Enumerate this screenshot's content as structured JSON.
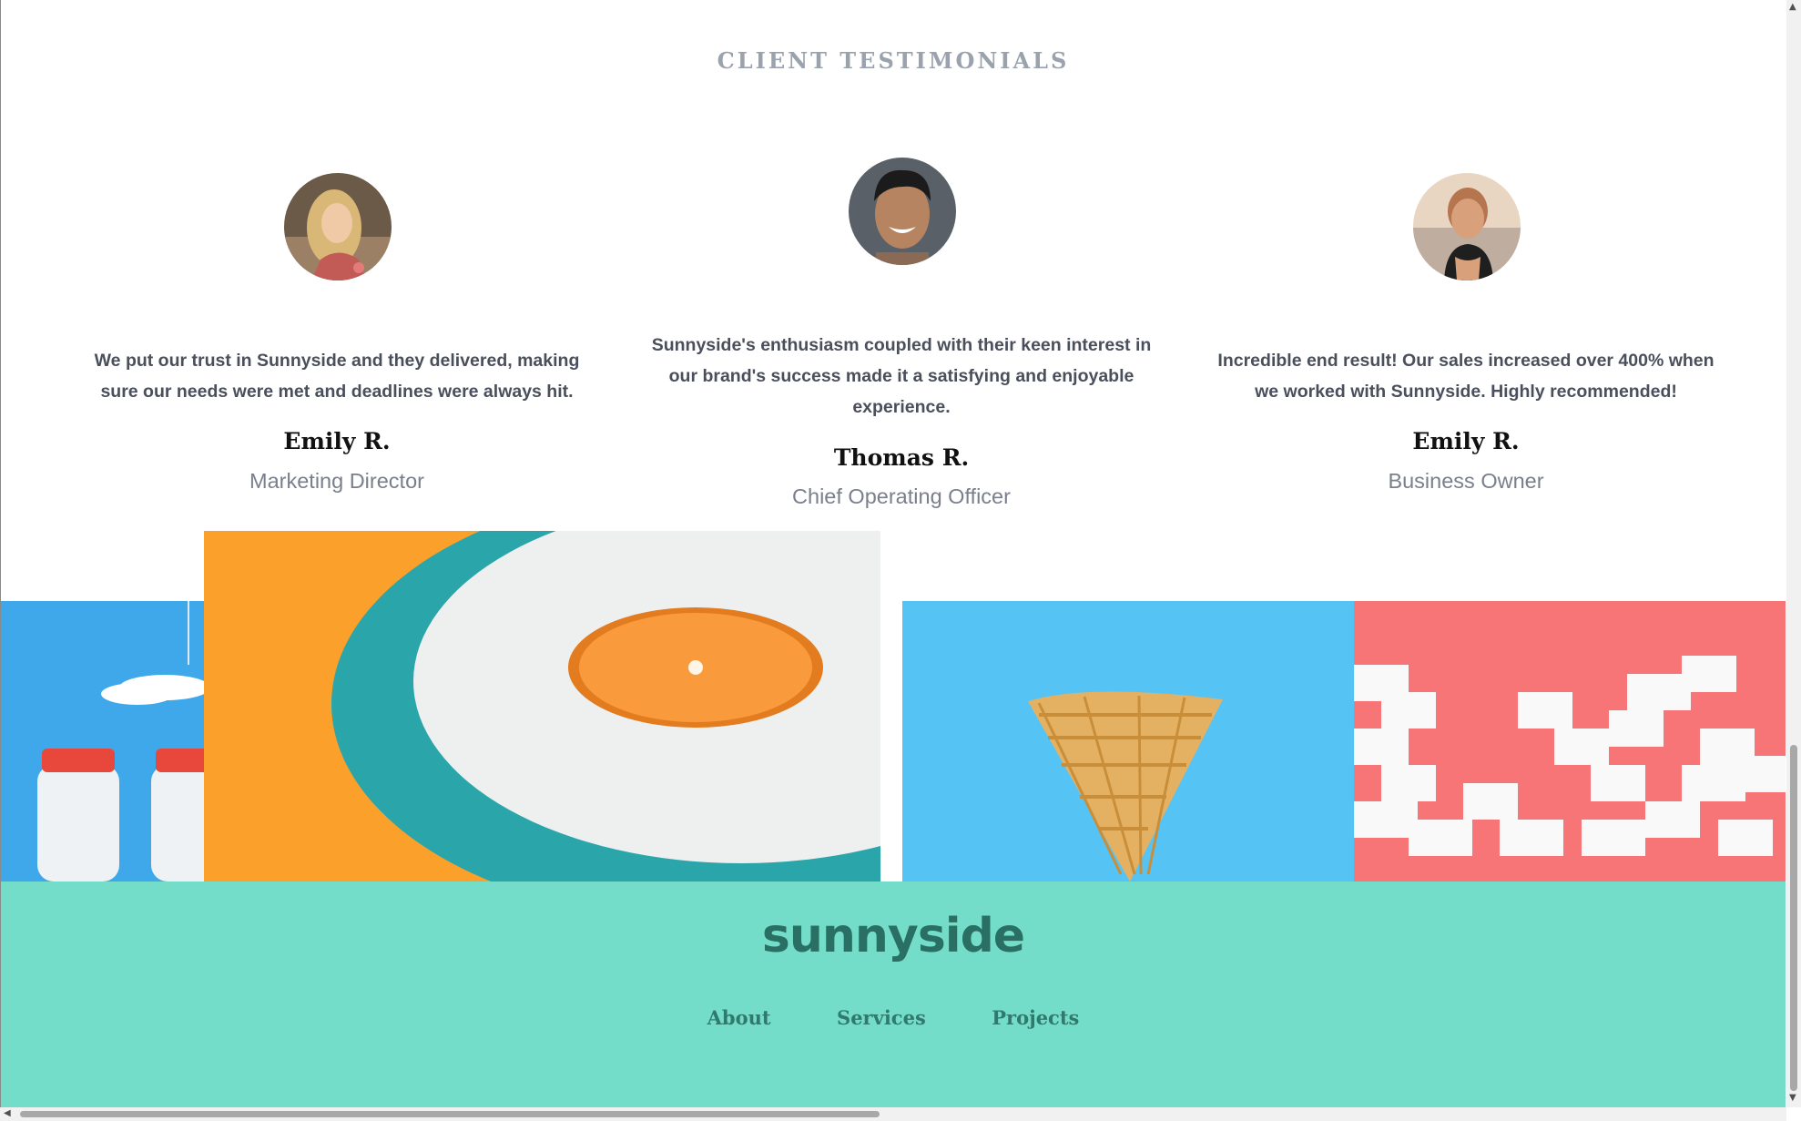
{
  "testimonials": {
    "title": "CLIENT TESTIMONIALS",
    "items": [
      {
        "quote": "We put our trust in Sunnyside and they delivered, making sure our needs were met and deadlines were always hit.",
        "name": "Emily R.",
        "role": "Marketing Director",
        "avatar": "woman-long-hair-avatar"
      },
      {
        "quote": "Sunnyside's enthusiasm coupled with their keen interest in our brand's success made it a satisfying and enjoyable experience.",
        "name": "Thomas R.",
        "role": "Chief Operating Officer",
        "avatar": "smiling-man-avatar"
      },
      {
        "quote": "Incredible end result! Our sales increased over 400% when we worked with Sunnyside. Highly recommended!",
        "name": "Emily R.",
        "role": "Business Owner",
        "avatar": "woman-short-hair-avatar"
      }
    ]
  },
  "gallery": {
    "images": [
      "milk-bottles-image",
      "orange-on-plate-image",
      "ice-cream-cone-image",
      "sugar-cubes-image"
    ]
  },
  "footer": {
    "logo": "sunnyside",
    "nav": [
      "About",
      "Services",
      "Projects"
    ]
  },
  "colors": {
    "footer_bg": "#74ddca",
    "footer_text": "#2a6f63",
    "orange_bg": "#fba02a",
    "blue_bg": "#56c3f5",
    "pink_bg": "#f77577"
  }
}
